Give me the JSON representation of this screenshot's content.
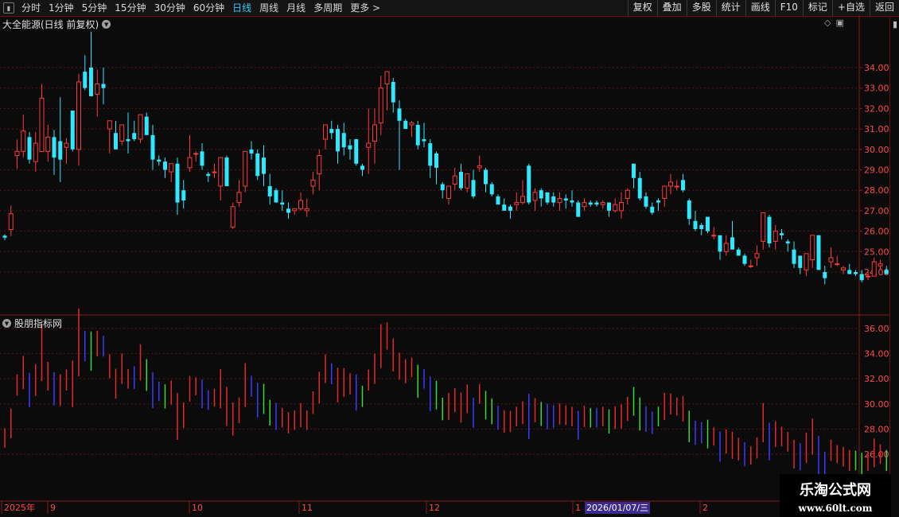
{
  "toolbar": {
    "tabs": [
      {
        "label": "分时",
        "active": false
      },
      {
        "label": "1分钟",
        "active": false
      },
      {
        "label": "5分钟",
        "active": false
      },
      {
        "label": "15分钟",
        "active": false
      },
      {
        "label": "30分钟",
        "active": false
      },
      {
        "label": "60分钟",
        "active": false
      },
      {
        "label": "日线",
        "active": true
      },
      {
        "label": "周线",
        "active": false
      },
      {
        "label": "月线",
        "active": false
      },
      {
        "label": "多周期",
        "active": false
      },
      {
        "label": "更多 >",
        "active": false
      }
    ],
    "right_buttons": [
      "复权",
      "叠加",
      "多股",
      "统计",
      "画线",
      "F10",
      "标记",
      "+自选",
      "返回"
    ]
  },
  "main_pane": {
    "title": "大全能源(日线 前复权)",
    "price_ticks": [
      "34.00",
      "33.00",
      "32.00",
      "31.00",
      "30.00",
      "29.00",
      "28.00",
      "27.00",
      "26.00",
      "25.00",
      "24.00"
    ]
  },
  "indicator_pane": {
    "title": "股朋指标网",
    "ticks": [
      "36.00",
      "34.00",
      "32.00",
      "30.00",
      "28.00",
      "26.00"
    ]
  },
  "date_axis": {
    "labels": [
      {
        "text": "2025年",
        "hl": true
      },
      {
        "text": "9",
        "hl": true
      },
      {
        "text": "10",
        "hl": true
      },
      {
        "text": "11",
        "hl": true
      },
      {
        "text": "12",
        "hl": true
      },
      {
        "text": "1",
        "hl": false
      },
      {
        "text": "2",
        "hl": true
      }
    ],
    "crosshair_date": "2026/01/07/三"
  },
  "watermark": {
    "title": "乐淘公式网",
    "url": "www.60lt.com"
  },
  "colors": {
    "up": "#ff3a3a",
    "down": "#2ee8ff",
    "grid": "#5a1515",
    "border": "#8b1a1a",
    "indicator_blue": "#3b3bff",
    "indicator_green": "#39d839",
    "indicator_red": "#e02a2a"
  },
  "chart_data": {
    "type": "candlestick",
    "candles": [
      [
        25.78,
        25.85,
        25.55,
        25.68
      ],
      [
        26.08,
        27.25,
        25.75,
        26.85
      ],
      [
        29.7,
        30.48,
        29.05,
        29.9
      ],
      [
        29.9,
        31.7,
        29.6,
        30.9
      ],
      [
        30.6,
        30.85,
        29.3,
        29.5
      ],
      [
        29.4,
        30.85,
        28.9,
        30.3
      ],
      [
        29.9,
        33.2,
        29.9,
        32.5
      ],
      [
        29.9,
        31.2,
        29.4,
        30.6
      ],
      [
        30.6,
        30.95,
        28.75,
        29.6
      ],
      [
        30.4,
        32.55,
        28.4,
        29.5
      ],
      [
        30.1,
        30.55,
        29.3,
        30.3
      ],
      [
        31.9,
        31.85,
        29.9,
        30.0
      ],
      [
        30.0,
        33.7,
        29.2,
        33.3
      ],
      [
        33.8,
        34.6,
        32.9,
        33.0
      ],
      [
        34.0,
        35.75,
        32.7,
        32.6
      ],
      [
        32.7,
        33.9,
        31.6,
        33.2
      ],
      [
        33.2,
        34.0,
        32.2,
        33.0
      ],
      [
        31.0,
        31.4,
        29.8,
        31.4
      ],
      [
        30.8,
        31.4,
        30.0,
        30.0
      ],
      [
        30.4,
        31.2,
        30.2,
        31.2
      ],
      [
        30.5,
        31.8,
        29.8,
        30.4
      ],
      [
        30.8,
        31.4,
        30.4,
        30.5
      ],
      [
        30.5,
        31.6,
        30.3,
        31.7
      ],
      [
        31.6,
        31.8,
        30.8,
        30.7
      ],
      [
        30.7,
        31.2,
        29.0,
        29.5
      ],
      [
        29.5,
        29.7,
        29.2,
        29.4
      ],
      [
        29.4,
        29.6,
        28.6,
        29.0
      ],
      [
        28.9,
        29.3,
        28.4,
        29.3
      ],
      [
        29.3,
        29.6,
        26.8,
        27.4
      ],
      [
        28.0,
        28.5,
        27.1,
        27.5
      ],
      [
        29.1,
        30.7,
        28.9,
        29.6
      ],
      [
        29.8,
        29.9,
        29.4,
        29.8
      ],
      [
        29.9,
        30.3,
        29.0,
        29.2
      ],
      [
        28.8,
        28.9,
        28.4,
        28.7
      ],
      [
        28.9,
        29.3,
        28.6,
        28.9
      ],
      [
        28.2,
        29.5,
        27.5,
        29.6
      ],
      [
        29.6,
        29.7,
        28.5,
        28.2
      ],
      [
        26.2,
        27.4,
        26.1,
        27.2
      ],
      [
        27.4,
        28.5,
        27.2,
        27.9
      ],
      [
        28.2,
        29.6,
        27.9,
        29.9
      ],
      [
        30.0,
        30.4,
        29.5,
        29.8
      ],
      [
        29.8,
        30.0,
        28.5,
        28.7
      ],
      [
        29.6,
        30.2,
        28.2,
        28.8
      ],
      [
        28.2,
        28.8,
        27.3,
        27.7
      ],
      [
        28.0,
        28.1,
        27.5,
        27.4
      ],
      [
        27.4,
        28.0,
        27.0,
        27.3
      ],
      [
        27.1,
        27.4,
        26.6,
        26.9
      ],
      [
        27.0,
        27.1,
        26.8,
        27.1
      ],
      [
        27.1,
        27.9,
        27.0,
        27.5
      ],
      [
        27.0,
        27.6,
        26.7,
        27.1
      ],
      [
        28.2,
        28.9,
        27.8,
        28.5
      ],
      [
        28.8,
        30.0,
        28.0,
        29.7
      ],
      [
        30.5,
        31.0,
        30.0,
        31.2
      ],
      [
        31.0,
        31.4,
        30.5,
        30.8
      ],
      [
        31.0,
        31.2,
        29.3,
        29.9
      ],
      [
        30.8,
        31.3,
        29.7,
        30.1
      ],
      [
        30.2,
        30.5,
        29.5,
        30.0
      ],
      [
        30.5,
        30.5,
        29.2,
        29.3
      ],
      [
        29.2,
        29.3,
        28.7,
        29.0
      ],
      [
        30.1,
        32.0,
        28.8,
        30.3
      ],
      [
        30.4,
        32.0,
        29.3,
        31.2
      ],
      [
        31.3,
        33.6,
        30.7,
        33.0
      ],
      [
        33.2,
        33.7,
        31.9,
        33.8
      ],
      [
        33.3,
        33.5,
        31.8,
        32.3
      ],
      [
        32.0,
        32.4,
        29.0,
        31.4
      ],
      [
        31.4,
        31.5,
        31.1,
        31.0
      ],
      [
        31.2,
        31.4,
        30.6,
        31.3
      ],
      [
        31.2,
        31.4,
        30.0,
        30.2
      ],
      [
        30.5,
        31.3,
        30.1,
        30.4
      ],
      [
        30.3,
        30.5,
        28.6,
        29.2
      ],
      [
        29.8,
        29.9,
        28.3,
        29.1
      ],
      [
        28.3,
        28.4,
        27.6,
        28.0
      ],
      [
        27.6,
        28.2,
        27.3,
        28.2
      ],
      [
        28.3,
        29.1,
        28.0,
        28.7
      ],
      [
        28.9,
        29.3,
        28.0,
        28.1
      ],
      [
        28.1,
        28.8,
        27.9,
        28.8
      ],
      [
        28.5,
        29.0,
        27.6,
        27.7
      ],
      [
        29.1,
        29.7,
        28.9,
        29.2
      ],
      [
        29.0,
        29.1,
        27.9,
        28.3
      ],
      [
        28.3,
        28.4,
        27.7,
        27.8
      ],
      [
        27.7,
        27.8,
        27.4,
        27.3
      ],
      [
        27.3,
        27.6,
        27.0,
        27.0
      ],
      [
        27.2,
        27.3,
        26.6,
        27.0
      ],
      [
        27.3,
        27.9,
        27.0,
        27.4
      ],
      [
        27.4,
        28.5,
        27.3,
        27.7
      ],
      [
        29.2,
        29.3,
        27.3,
        27.4
      ],
      [
        27.5,
        28.1,
        27.0,
        27.9
      ],
      [
        28.0,
        28.1,
        27.2,
        27.6
      ],
      [
        27.9,
        27.8,
        27.3,
        27.4
      ],
      [
        27.7,
        27.9,
        27.2,
        27.4
      ],
      [
        27.4,
        27.9,
        27.0,
        27.6
      ],
      [
        27.6,
        27.8,
        27.1,
        27.5
      ],
      [
        27.5,
        28.0,
        27.2,
        27.4
      ],
      [
        27.4,
        27.5,
        26.7,
        26.7
      ],
      [
        27.2,
        27.6,
        27.0,
        27.4
      ],
      [
        27.4,
        27.5,
        27.2,
        27.3
      ],
      [
        27.4,
        27.5,
        27.2,
        27.3
      ],
      [
        27.3,
        27.5,
        27.1,
        27.4
      ],
      [
        27.4,
        27.4,
        26.7,
        27.0
      ],
      [
        27.0,
        27.6,
        26.9,
        27.3
      ],
      [
        27.0,
        27.9,
        26.6,
        27.4
      ],
      [
        27.6,
        28.1,
        27.3,
        28.0
      ],
      [
        29.3,
        29.3,
        28.1,
        28.6
      ],
      [
        28.6,
        28.9,
        27.5,
        27.6
      ],
      [
        27.7,
        27.9,
        27.1,
        27.2
      ],
      [
        27.2,
        27.4,
        26.8,
        26.9
      ],
      [
        27.5,
        27.6,
        27.0,
        27.4
      ],
      [
        27.6,
        28.2,
        27.2,
        28.2
      ],
      [
        28.2,
        28.8,
        27.8,
        28.4
      ],
      [
        28.2,
        28.5,
        28.0,
        28.2
      ],
      [
        28.5,
        28.8,
        27.9,
        28.0
      ],
      [
        27.5,
        27.6,
        26.3,
        26.6
      ],
      [
        26.5,
        27.0,
        26.0,
        26.1
      ],
      [
        26.3,
        26.4,
        25.8,
        26.1
      ],
      [
        26.7,
        26.6,
        25.9,
        26.0
      ],
      [
        25.8,
        26.2,
        25.6,
        25.8
      ],
      [
        25.8,
        25.7,
        24.6,
        25.0
      ],
      [
        25.0,
        25.8,
        24.8,
        25.4
      ],
      [
        25.7,
        26.5,
        25.1,
        25.1
      ],
      [
        25.1,
        25.2,
        24.8,
        24.8
      ],
      [
        24.8,
        24.9,
        24.3,
        24.4
      ],
      [
        24.3,
        24.6,
        24.2,
        24.3
      ],
      [
        24.7,
        25.3,
        24.3,
        24.9
      ],
      [
        25.5,
        26.9,
        25.1,
        26.9
      ],
      [
        26.7,
        26.8,
        25.2,
        25.4
      ],
      [
        25.5,
        26.3,
        25.1,
        26.0
      ],
      [
        25.9,
        26.1,
        25.6,
        25.8
      ],
      [
        25.5,
        25.6,
        25.0,
        25.4
      ],
      [
        25.1,
        25.5,
        24.2,
        24.4
      ],
      [
        24.8,
        24.8,
        23.9,
        24.2
      ],
      [
        24.1,
        24.7,
        23.8,
        24.9
      ],
      [
        24.6,
        25.0,
        24.2,
        25.8
      ],
      [
        25.8,
        25.8,
        24.2,
        24.1
      ],
      [
        24.0,
        24.3,
        23.4,
        23.7
      ],
      [
        24.5,
        25.2,
        24.2,
        24.7
      ],
      [
        24.4,
        24.8,
        24.3,
        24.4
      ],
      [
        24.1,
        24.3,
        23.9,
        24.2
      ],
      [
        24.1,
        24.4,
        23.9,
        23.9
      ],
      [
        24.0,
        24.1,
        23.8,
        23.9
      ],
      [
        23.9,
        24.1,
        23.5,
        23.6
      ],
      [
        23.8,
        24.0,
        23.6,
        23.8
      ],
      [
        23.8,
        24.7,
        23.8,
        24.5
      ],
      [
        24.3,
        24.6,
        24.1,
        24.4
      ],
      [
        24.1,
        24.3,
        23.9,
        23.9
      ],
      [
        24.0,
        24.2,
        23.7,
        23.8
      ],
      [
        24.1,
        24.5,
        23.8,
        24.0
      ],
      [
        24.1,
        24.6,
        24.0,
        23.8
      ],
      [
        23.6,
        23.9,
        23.3,
        23.3
      ],
      [
        23.6,
        23.8,
        23.1,
        23.2
      ],
      [
        23.3,
        23.5,
        22.9,
        23.0
      ],
      [
        23.1,
        23.5,
        22.8,
        23.3
      ],
      [
        23.4,
        23.8,
        23.1,
        23.7
      ],
      [
        23.6,
        23.9,
        23.3,
        23.5
      ]
    ],
    "indicator_colors": "per-bar"
  }
}
